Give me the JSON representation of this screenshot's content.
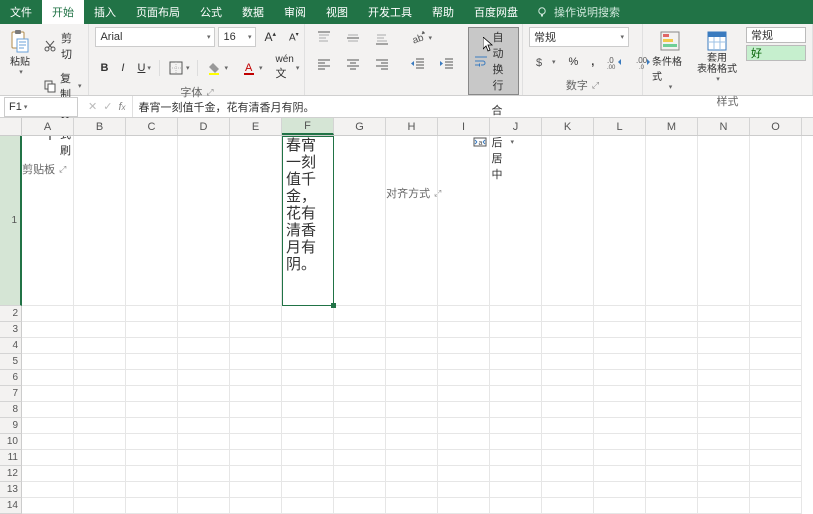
{
  "tabs": {
    "file": "文件",
    "home": "开始",
    "insert": "插入",
    "layout": "页面布局",
    "formula": "公式",
    "data": "数据",
    "review": "审阅",
    "view": "视图",
    "dev": "开发工具",
    "help": "帮助",
    "netdisk": "百度网盘",
    "tellme": "操作说明搜索"
  },
  "ribbon": {
    "clipboard": {
      "cut": "剪切",
      "copy": "复制",
      "painter": "格式刷",
      "group": "剪贴板",
      "paste": "粘贴"
    },
    "font": {
      "name": "Arial",
      "size": "16",
      "group": "字体"
    },
    "align": {
      "wrap": "自动换行",
      "merge": "合并后居中",
      "group": "对齐方式"
    },
    "number": {
      "format": "常规",
      "group": "数字"
    },
    "styles": {
      "cond": "条件格式",
      "tablefmt": "套用\n表格格式",
      "normal": "常规",
      "good": "好",
      "group": "样式"
    }
  },
  "cellref": "F1",
  "formula_text": "春宵一刻值千金，花有清香月有阴。",
  "cell_text": "春宵一刻值千金，花有清香月有阴。",
  "cols": [
    "A",
    "B",
    "C",
    "D",
    "E",
    "F",
    "G",
    "H",
    "I",
    "J",
    "K",
    "L",
    "M",
    "N",
    "O"
  ],
  "rows": [
    "1",
    "2",
    "3",
    "4",
    "5",
    "6",
    "7",
    "8",
    "9",
    "10",
    "11",
    "12",
    "13",
    "14"
  ]
}
